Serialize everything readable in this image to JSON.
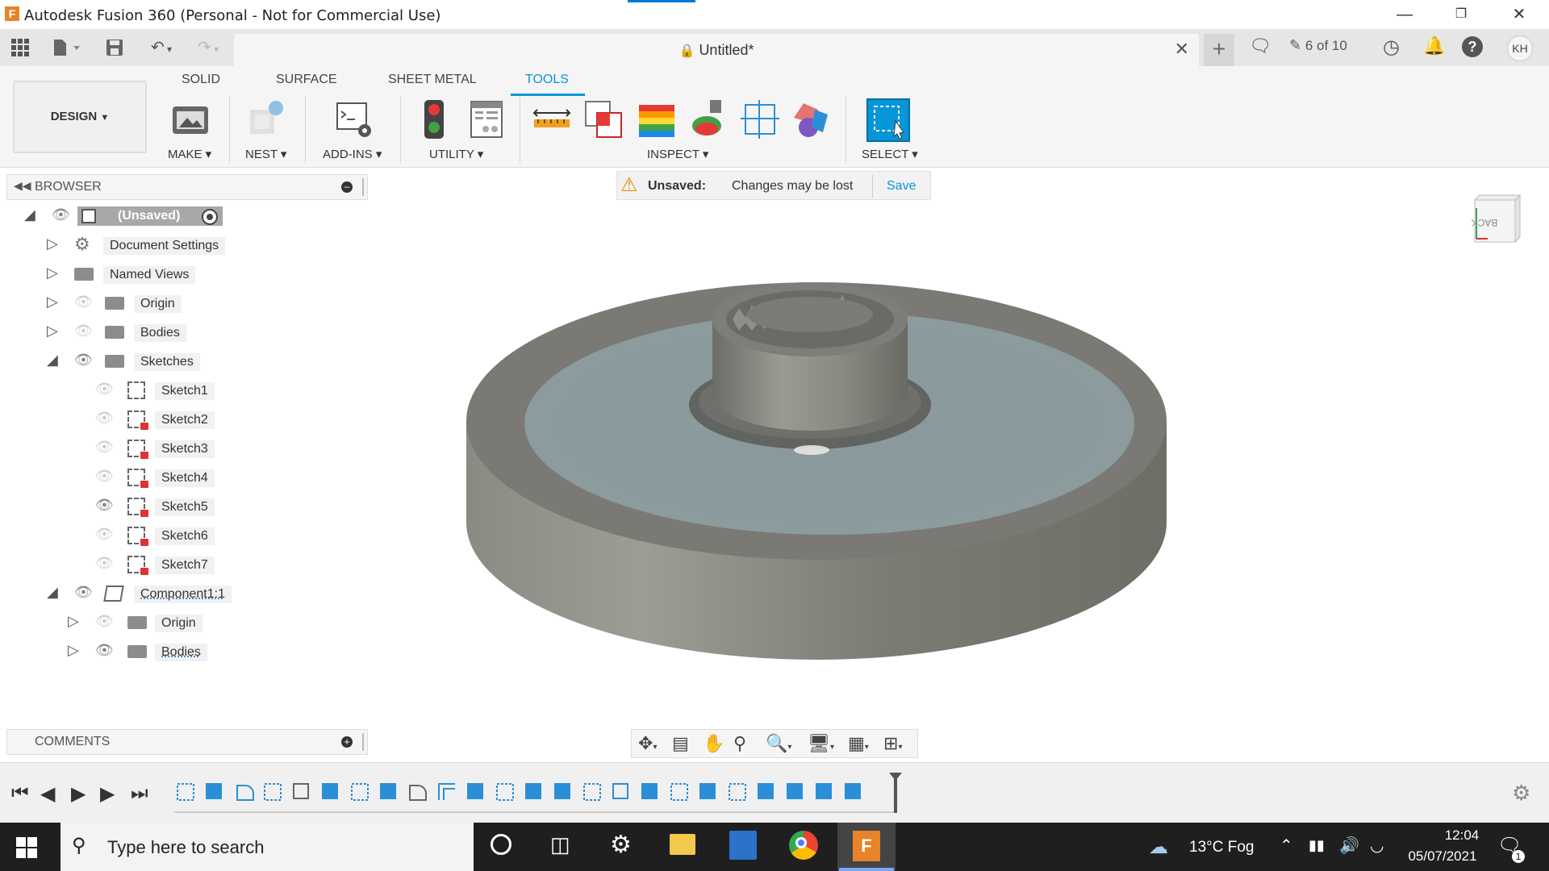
{
  "window": {
    "title": "Autodesk Fusion 360 (Personal - Not for Commercial Use)",
    "app_icon": "F",
    "controls": [
      "minimize-icon",
      "restore-icon",
      "close-icon"
    ]
  },
  "tabstrip": {
    "document_title": "Untitled*",
    "job_status": "6 of 10",
    "user_initials": "KH"
  },
  "ribbon": {
    "workspace": "DESIGN",
    "tabs": [
      "SOLID",
      "SURFACE",
      "SHEET METAL",
      "TOOLS"
    ],
    "active_tab": "TOOLS",
    "groups": {
      "make": "MAKE",
      "nest": "NEST",
      "addins": "ADD-INS",
      "utility": "UTILITY",
      "inspect": "INSPECT",
      "select": "SELECT"
    }
  },
  "browser": {
    "header": "BROWSER",
    "root": "(Unsaved)",
    "items": {
      "document_settings": "Document Settings",
      "named_views": "Named Views",
      "origin": "Origin",
      "bodies": "Bodies",
      "sketches": "Sketches",
      "sketch1": "Sketch1",
      "sketch2": "Sketch2",
      "sketch3": "Sketch3",
      "sketch4": "Sketch4",
      "sketch5": "Sketch5",
      "sketch6": "Sketch6",
      "sketch7": "Sketch7",
      "component": "Component1:1",
      "comp_origin": "Origin",
      "comp_bodies": "Bodies"
    }
  },
  "notice": {
    "label": "Unsaved:",
    "message": "Changes may be lost",
    "action": "Save"
  },
  "viewcube": {
    "face": "BACK"
  },
  "comments": {
    "header": "COMMENTS"
  },
  "taskbar": {
    "search_placeholder": "Type here to search",
    "weather": "13°C  Fog",
    "time": "12:04",
    "date": "05/07/2021",
    "notification_count": "1"
  }
}
